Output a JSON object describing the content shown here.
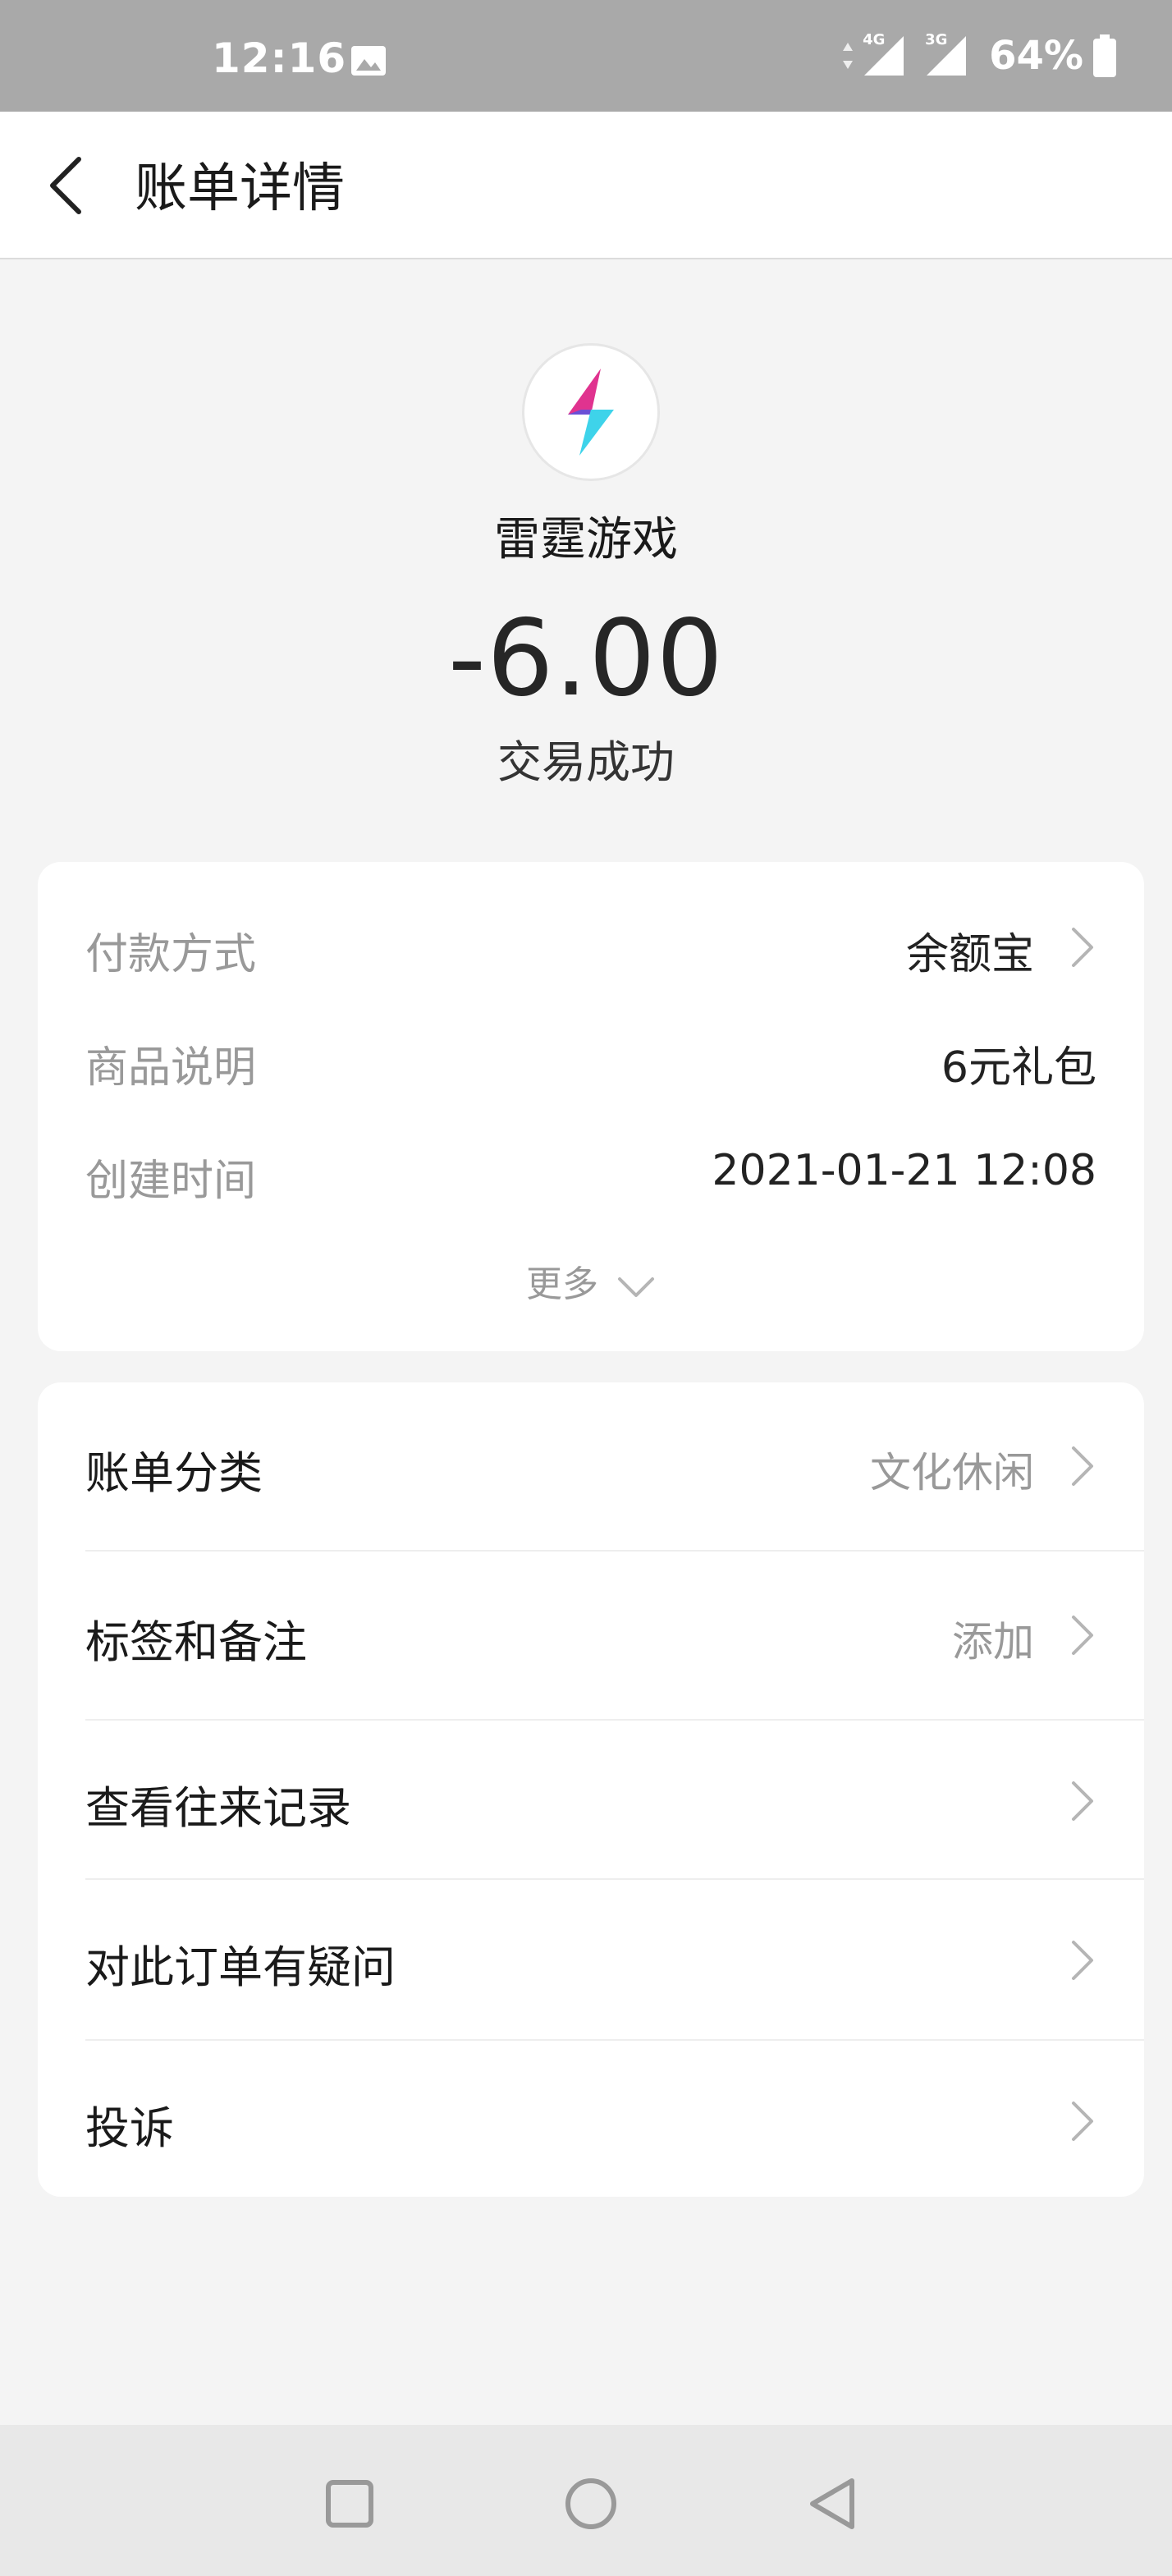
{
  "status_bar": {
    "time": "12:16",
    "network_1": "4G",
    "network_2": "3G",
    "battery": "64%"
  },
  "header": {
    "title": "账单详情",
    "back_icon": "chevron-left-icon"
  },
  "merchant": {
    "name": "雷霆游戏",
    "amount": "-6.00",
    "status": "交易成功",
    "logo_icon": "lightning-bolt-icon"
  },
  "details": {
    "payment_method": {
      "label": "付款方式",
      "value": "余额宝"
    },
    "description": {
      "label": "商品说明",
      "value": "6元礼包"
    },
    "created_time": {
      "label": "创建时间",
      "value": "2021-01-21 12:08"
    },
    "more": "更多"
  },
  "actions": {
    "category": {
      "label": "账单分类",
      "value": "文化休闲"
    },
    "tags": {
      "label": "标签和备注",
      "value": "添加"
    },
    "history": {
      "label": "查看往来记录"
    },
    "question": {
      "label": "对此订单有疑问"
    },
    "complaint": {
      "label": "投诉"
    }
  },
  "colors": {
    "status_bar": "#a9a9a9",
    "background": "#f4f4f4",
    "card": "#ffffff",
    "muted_text": "#999999",
    "logo_pink": "#e0338f",
    "logo_cyan": "#3ed3ea",
    "logo_purple": "#6a4fd6"
  }
}
